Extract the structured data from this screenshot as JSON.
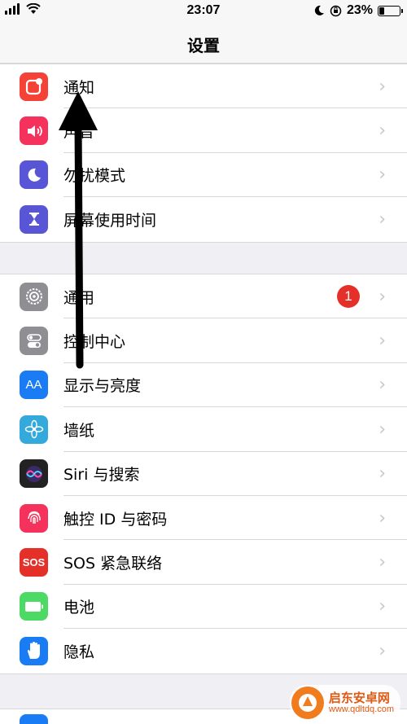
{
  "status_bar": {
    "time": "23:07",
    "battery_percent": "23%",
    "battery_level": 0.23,
    "icons": [
      "signal-icon",
      "wifi-icon",
      "moon-icon",
      "orientation-lock-icon",
      "battery-icon"
    ]
  },
  "nav": {
    "title": "设置"
  },
  "groups": [
    {
      "items": [
        {
          "label": "通知",
          "icon": "notifications-icon",
          "color": "#f44336"
        },
        {
          "label": "声音",
          "icon": "sound-icon",
          "color": "#f5325b"
        },
        {
          "label": "勿扰模式",
          "icon": "moon-icon",
          "color": "#5856d6"
        },
        {
          "label": "屏幕使用时间",
          "icon": "hourglass-icon",
          "color": "#5856d6"
        }
      ]
    },
    {
      "items": [
        {
          "label": "通用",
          "icon": "gear-icon",
          "color": "#8e8e93",
          "badge": "1"
        },
        {
          "label": "控制中心",
          "icon": "toggles-icon",
          "color": "#8e8e93"
        },
        {
          "label": "显示与亮度",
          "icon": "aa-text-icon",
          "color": "#1a7cf5"
        },
        {
          "label": "墙纸",
          "icon": "flower-icon",
          "color": "#34aadc"
        },
        {
          "label": "Siri 与搜索",
          "icon": "siri-icon",
          "color": "#222222"
        },
        {
          "label": "触控 ID 与密码",
          "icon": "fingerprint-icon",
          "color": "#f5325b"
        },
        {
          "label": "SOS 紧急联络",
          "icon": "sos-icon",
          "color": "#e5302a",
          "icon_text": "SOS"
        },
        {
          "label": "电池",
          "icon": "battery-icon",
          "color": "#4cd964"
        },
        {
          "label": "隐私",
          "icon": "hand-icon",
          "color": "#1a7cf5"
        }
      ]
    }
  ],
  "chevron": "›",
  "aa_text": "AA",
  "watermark": {
    "title": "启东安卓网",
    "url": "www.qdltdq.com"
  }
}
